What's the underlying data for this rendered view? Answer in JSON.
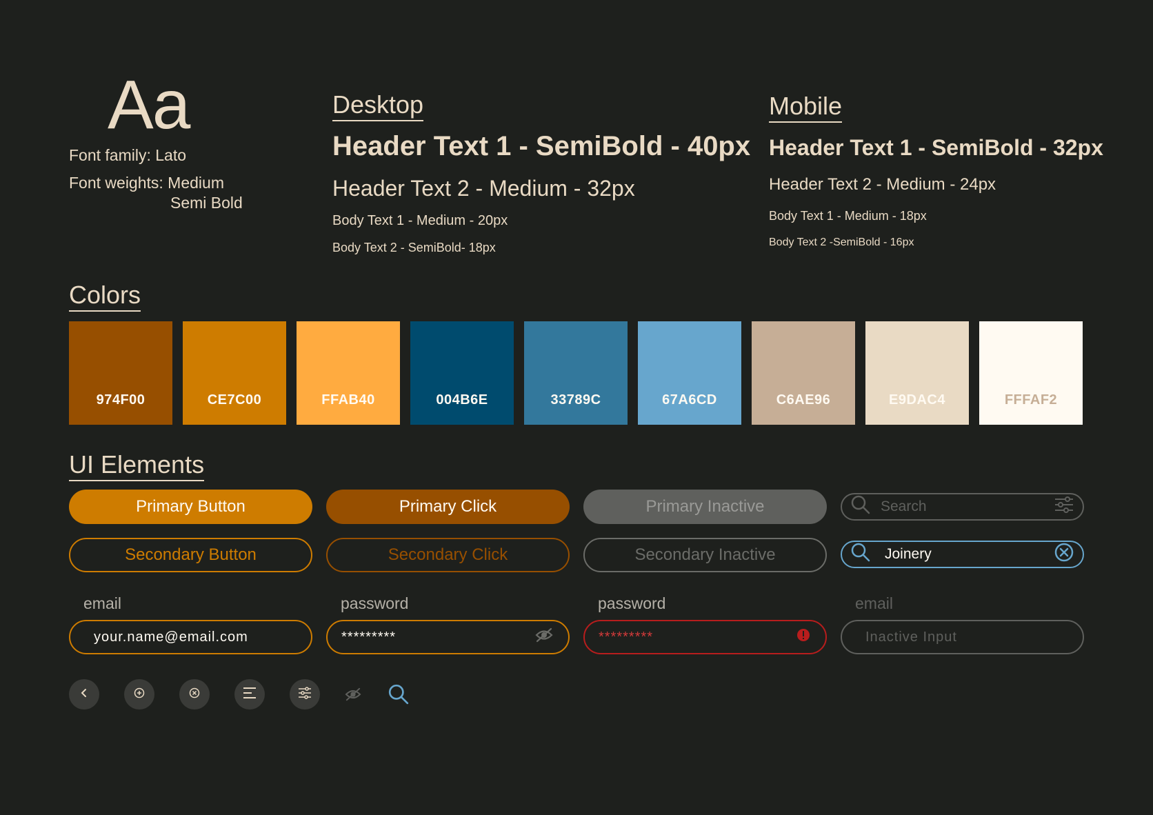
{
  "typography": {
    "sample": "Aa",
    "font_family_line": "Font family:  Lato",
    "font_weights_label": "Font weights: Medium",
    "font_weights_second": "Semi Bold"
  },
  "desktop": {
    "title": "Desktop",
    "h1": "Header Text 1 - SemiBold - 40px",
    "h2": "Header Text 2 - Medium - 32px",
    "b1": "Body Text 1 - Medium - 20px",
    "b2": "Body Text 2 - SemiBold- 18px"
  },
  "mobile": {
    "title": "Mobile",
    "h1": "Header Text 1 - SemiBold - 32px",
    "h2": "Header Text 2 - Medium - 24px",
    "b1": "Body Text 1 - Medium - 18px",
    "b2": "Body Text 2 -SemiBold - 16px"
  },
  "colors": {
    "title": "Colors",
    "swatches": [
      {
        "hex": "#974F00",
        "label": "974F00",
        "text_color": "#FFFAF2"
      },
      {
        "hex": "#CE7C00",
        "label": "CE7C00",
        "text_color": "#FFFAF2"
      },
      {
        "hex": "#FFAB40",
        "label": "FFAB40",
        "text_color": "#FFFAF2"
      },
      {
        "hex": "#004B6E",
        "label": "004B6E",
        "text_color": "#FFFAF2"
      },
      {
        "hex": "#33789C",
        "label": "33789C",
        "text_color": "#FFFAF2"
      },
      {
        "hex": "#67A6CD",
        "label": "67A6CD",
        "text_color": "#FFFAF2"
      },
      {
        "hex": "#C6AE96",
        "label": "C6AE96",
        "text_color": "#FFFAF2"
      },
      {
        "hex": "#E9DAC4",
        "label": "E9DAC4",
        "text_color": "#FFFAF2"
      },
      {
        "hex": "#FFFAF2",
        "label": "FFFAF2",
        "text_color": "#C6AE96"
      }
    ]
  },
  "ui": {
    "title": "UI Elements",
    "primary_button": "Primary Button",
    "primary_click": "Primary Click",
    "primary_inactive": "Primary Inactive",
    "secondary_button": "Secondary Button",
    "secondary_click": "Secondary Click",
    "secondary_inactive": "Secondary Inactive",
    "search_placeholder": "Search",
    "search_value": "Joinery",
    "labels": {
      "email": "email",
      "password": "password",
      "password2": "password",
      "email_inactive": "email"
    },
    "fields": {
      "email_value": "your.name@email.com",
      "password_value": "*********",
      "password_error_value": "*********",
      "inactive_placeholder": "Inactive Input"
    },
    "icons": [
      "chevron-left-icon",
      "plus-circle-icon",
      "close-circle-icon",
      "menu-icon",
      "filter-icon",
      "eye-off-icon",
      "search-icon"
    ]
  },
  "palette": {
    "background": "#1E201D",
    "accent": "#CE7C00",
    "accent_dark": "#974F00",
    "blue": "#67A6CD",
    "error": "#B81D1D",
    "text": "#E9DAC4"
  }
}
